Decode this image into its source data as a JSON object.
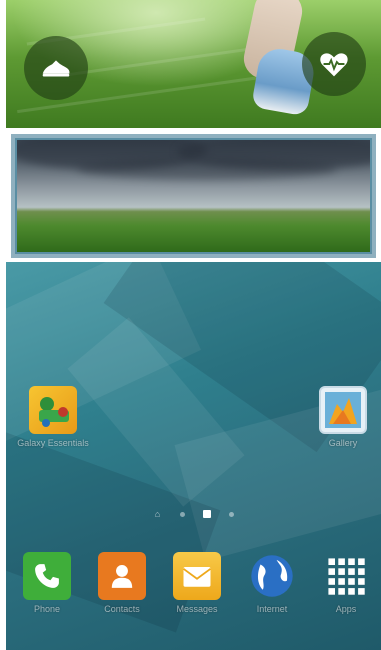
{
  "widgets": {
    "fitness": {
      "shoe_icon": "running-shoe-icon",
      "heart_icon": "heart-rate-icon"
    },
    "landscape": {
      "description_icon": "landscape-photo"
    }
  },
  "home": {
    "apps": [
      {
        "label": "Galaxy Essentials",
        "icon": "essentials-icon"
      },
      {
        "label": "Gallery",
        "icon": "gallery-icon"
      }
    ],
    "page_indicator": {
      "home_glyph": "⌂",
      "pages": 3,
      "active_index": 1
    }
  },
  "dock": [
    {
      "label": "Phone",
      "icon": "phone-icon",
      "color": "#3fae3a"
    },
    {
      "label": "Contacts",
      "icon": "contacts-icon",
      "color": "#e8791f"
    },
    {
      "label": "Messages",
      "icon": "messages-icon",
      "color": "#f2b623"
    },
    {
      "label": "Internet",
      "icon": "internet-icon",
      "color": "#2a6fc4"
    },
    {
      "label": "Apps",
      "icon": "apps-grid-icon",
      "color": "#ffffff"
    }
  ]
}
